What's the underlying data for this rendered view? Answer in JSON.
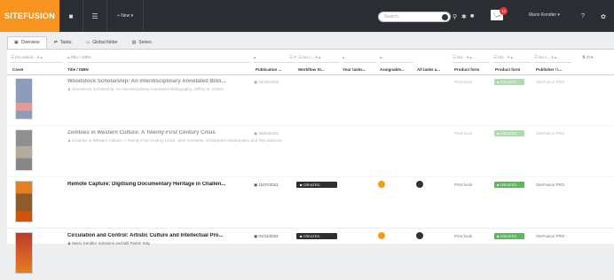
{
  "topbar": {
    "logo": "SITEFUSION",
    "new_label": "+ New ▾",
    "search_placeholder": "Search",
    "mail_count": "12",
    "user_name": "Mario Kendler ▾"
  },
  "tabs": [
    {
      "icon": "▣",
      "label": "Overview"
    },
    {
      "icon": "⇄",
      "label": "Tasks"
    },
    {
      "icon": "▭",
      "label": "Global folder"
    },
    {
      "icon": "▤",
      "label": "Series"
    }
  ],
  "filters": [
    "☰ No selecti... ▾ ▴",
    "▴ Title / ISBN",
    "▴",
    "☰ Publica... ▴",
    "☰ No c... ▾ ▴",
    "▴",
    "▴",
    "☰ No... ▾ ▴",
    "☰ No... ▾ ▴",
    "☰ No c... ▾ ▴"
  ],
  "columns": [
    "Cover",
    "Title / ISBN",
    "Publication ...",
    "Workflow St...",
    "Your tasks...",
    "Assignable...",
    "All tasks a...",
    "Product form",
    "Product form",
    "Publisher / I..."
  ],
  "rows": [
    {
      "title": "Woodstock Scholarship: An Interdisciplinary Annotated Bibli...",
      "sub": "♟ Woodstock Scholarship: An Interdisciplinary Annotated Bibliography, Jeffrey N. Gatten",
      "date": "▣ 01/15/2022",
      "workflow": "",
      "product_form": "Print book",
      "status": "■ CREATED",
      "publisher": "SiteFusion PRO",
      "faded": true
    },
    {
      "title": "Zombies in Western Culture: A Twenty-First Century Crisis",
      "sub": "♟ Zombies in Western Culture: A Twenty-First Century Crisis, John Vervaeke, Christopher Mastropietro and Filip Miscevic",
      "date": "▣ 05/03/2022",
      "workflow": "",
      "product_form": "Print book",
      "status": "■ CREATED",
      "publisher": "SiteFusion PRO",
      "faded": true
    },
    {
      "title": "Remote Capture: Digitising Documentary Heritage in Challen...",
      "sub": "",
      "date": "▣ 11/07/2021",
      "workflow": "■ CREATED",
      "product_form": "Print book",
      "status": "■ CREATED",
      "publisher": "SiteFusion PRO",
      "faded": false
    },
    {
      "title": "Circulation and Control: Artistic Culture and Intellectual Pro...",
      "sub": "♟ Mario Kendler Solutions and Bill Parker Italy",
      "date": "▣ 01/11/2022",
      "workflow": "■ CREATED",
      "product_form": "Print book",
      "status": "■ CREATED",
      "publisher": "SiteFusion PRO",
      "faded": false
    }
  ],
  "colors": {
    "accent": "#f7941d",
    "topbar": "#2b2f33",
    "status_green": "#5cb85c",
    "assign_orange": "#f39c12"
  }
}
